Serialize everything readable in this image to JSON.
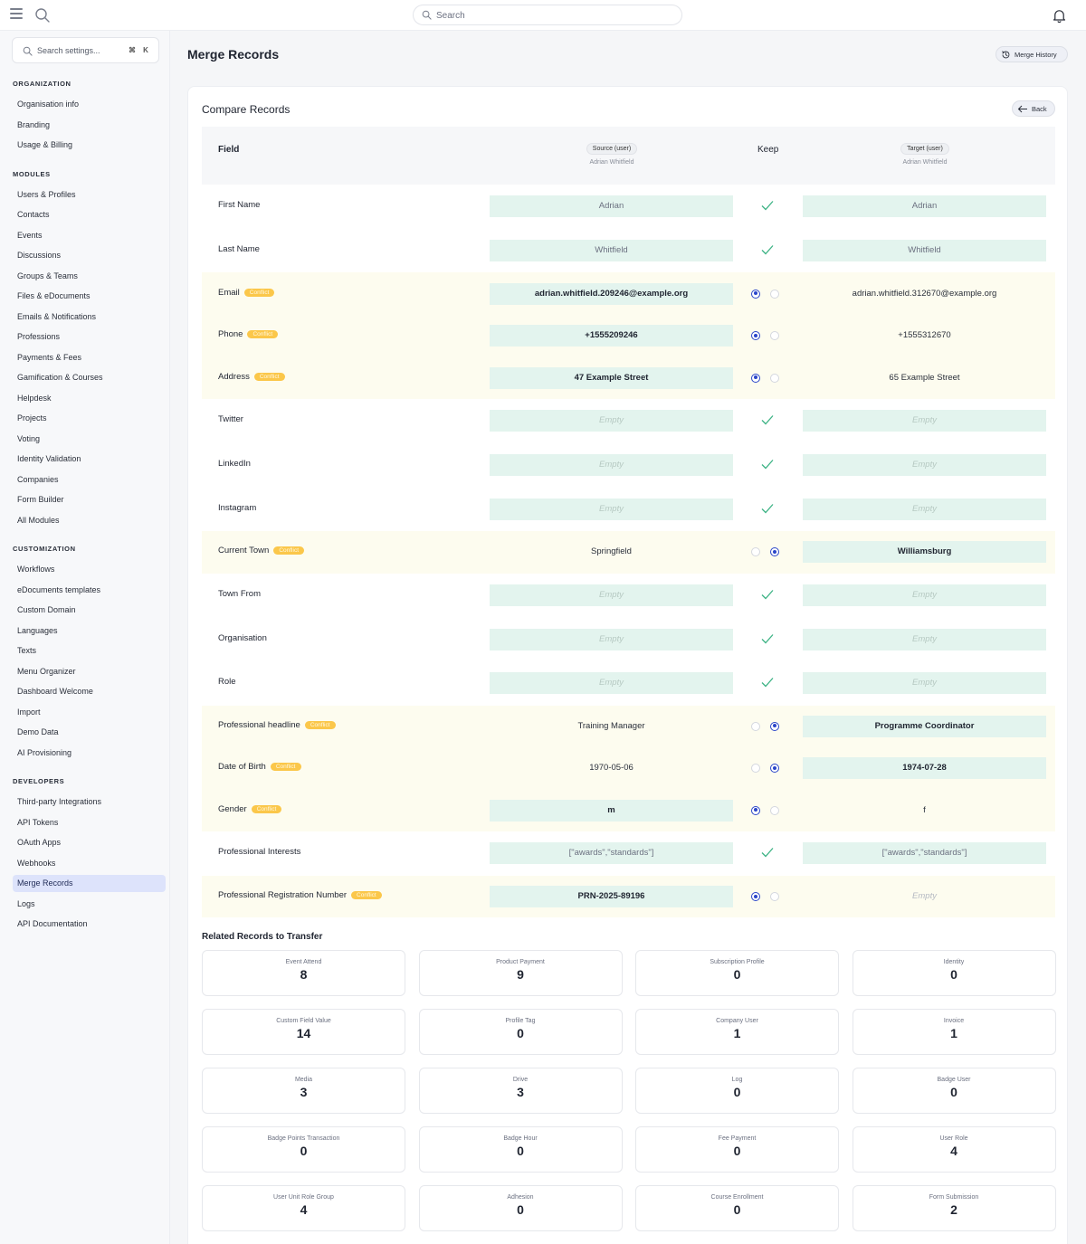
{
  "topbar": {
    "search_placeholder": "Search"
  },
  "sidebar": {
    "search_placeholder": "Search settings...",
    "shortcut_mod": "⌘",
    "shortcut_key": "K",
    "sections": [
      {
        "title": "ORGANIZATION",
        "items": [
          "Organisation info",
          "Branding",
          "Usage & Billing"
        ]
      },
      {
        "title": "MODULES",
        "items": [
          "Users & Profiles",
          "Contacts",
          "Events",
          "Discussions",
          "Groups & Teams",
          "Files & eDocuments",
          "Emails & Notifications",
          "Professions",
          "Payments & Fees",
          "Gamification & Courses",
          "Helpdesk",
          "Projects",
          "Voting",
          "Identity Validation",
          "Companies",
          "Form Builder",
          "All Modules"
        ]
      },
      {
        "title": "CUSTOMIZATION",
        "items": [
          "Workflows",
          "eDocuments templates",
          "Custom Domain",
          "Languages",
          "Texts",
          "Menu Organizer",
          "Dashboard Welcome",
          "Import",
          "Demo Data",
          "AI Provisioning"
        ]
      },
      {
        "title": "DEVELOPERS",
        "items": [
          "Third-party Integrations",
          "API Tokens",
          "OAuth Apps",
          "Webhooks",
          "Merge Records",
          "Logs",
          "API Documentation"
        ]
      }
    ],
    "active_item": "Merge Records"
  },
  "page": {
    "title": "Merge Records",
    "history_button": "Merge History"
  },
  "compare": {
    "title": "Compare Records",
    "back_button": "Back",
    "header": {
      "field": "Field",
      "keep": "Keep",
      "source_badge": "Source (user)",
      "source_name": "Adrian Whitfield",
      "target_badge": "Target (user)",
      "target_name": "Adrian Whitfield"
    },
    "conflict_label": "Conflict",
    "empty_label": "Empty",
    "rows": [
      {
        "field": "First Name",
        "source": "Adrian",
        "target": "Adrian",
        "conflict": false,
        "keep": "both"
      },
      {
        "field": "Last Name",
        "source": "Whitfield",
        "target": "Whitfield",
        "conflict": false,
        "keep": "both"
      },
      {
        "field": "Email",
        "source": "adrian.whitfield.209246@example.org",
        "target": "adrian.whitfield.312670@example.org",
        "conflict": true,
        "keep": "source"
      },
      {
        "field": "Phone",
        "source": "+1555209246",
        "target": "+1555312670",
        "conflict": true,
        "keep": "source"
      },
      {
        "field": "Address",
        "source": "47 Example Street",
        "target": "65 Example Street",
        "conflict": true,
        "keep": "source"
      },
      {
        "field": "Twitter",
        "source": "",
        "target": "",
        "conflict": false,
        "keep": "both"
      },
      {
        "field": "LinkedIn",
        "source": "",
        "target": "",
        "conflict": false,
        "keep": "both"
      },
      {
        "field": "Instagram",
        "source": "",
        "target": "",
        "conflict": false,
        "keep": "both"
      },
      {
        "field": "Current Town",
        "source": "Springfield",
        "target": "Williamsburg",
        "conflict": true,
        "keep": "target"
      },
      {
        "field": "Town From",
        "source": "",
        "target": "",
        "conflict": false,
        "keep": "both"
      },
      {
        "field": "Organisation",
        "source": "",
        "target": "",
        "conflict": false,
        "keep": "both"
      },
      {
        "field": "Role",
        "source": "",
        "target": "",
        "conflict": false,
        "keep": "both"
      },
      {
        "field": "Professional headline",
        "source": "Training Manager",
        "target": "Programme Coordinator",
        "conflict": true,
        "keep": "target"
      },
      {
        "field": "Date of Birth",
        "source": "1970-05-06",
        "target": "1974-07-28",
        "conflict": true,
        "keep": "target"
      },
      {
        "field": "Gender",
        "source": "m",
        "target": "f",
        "conflict": true,
        "keep": "source"
      },
      {
        "field": "Professional Interests",
        "source": "[\"awards\",\"standards\"]",
        "target": "[\"awards\",\"standards\"]",
        "conflict": false,
        "keep": "both"
      },
      {
        "field": "Professional Registration Number",
        "source": "PRN-2025-89196",
        "target": "",
        "conflict": true,
        "keep": "source"
      }
    ]
  },
  "related": {
    "title": "Related Records to Transfer",
    "items": [
      {
        "label": "Event Attend",
        "count": "8"
      },
      {
        "label": "Product Payment",
        "count": "9"
      },
      {
        "label": "Subscription Profile",
        "count": "0"
      },
      {
        "label": "Identity",
        "count": "0"
      },
      {
        "label": "Custom Field Value",
        "count": "14"
      },
      {
        "label": "Profile Tag",
        "count": "0"
      },
      {
        "label": "Company User",
        "count": "1"
      },
      {
        "label": "Invoice",
        "count": "1"
      },
      {
        "label": "Media",
        "count": "3"
      },
      {
        "label": "Drive",
        "count": "3"
      },
      {
        "label": "Log",
        "count": "0"
      },
      {
        "label": "Badge User",
        "count": "0"
      },
      {
        "label": "Badge Points Transaction",
        "count": "0"
      },
      {
        "label": "Badge Hour",
        "count": "0"
      },
      {
        "label": "Fee Payment",
        "count": "0"
      },
      {
        "label": "User Role",
        "count": "4"
      },
      {
        "label": "User Unit Role Group",
        "count": "4"
      },
      {
        "label": "Adhesion",
        "count": "0"
      },
      {
        "label": "Course Enrollment",
        "count": "0"
      },
      {
        "label": "Form Submission",
        "count": "2"
      }
    ]
  },
  "colors": {
    "accent": "#2b46c9",
    "conflict_pill": "#fbc74a",
    "kept_value_bg": "#e3f4ee",
    "check": "#3db385",
    "active_nav": "#dde3fb"
  },
  "icons": [
    "menu-icon",
    "search-icon",
    "bell-icon",
    "history-icon",
    "arrow-left-icon",
    "check-icon"
  ]
}
